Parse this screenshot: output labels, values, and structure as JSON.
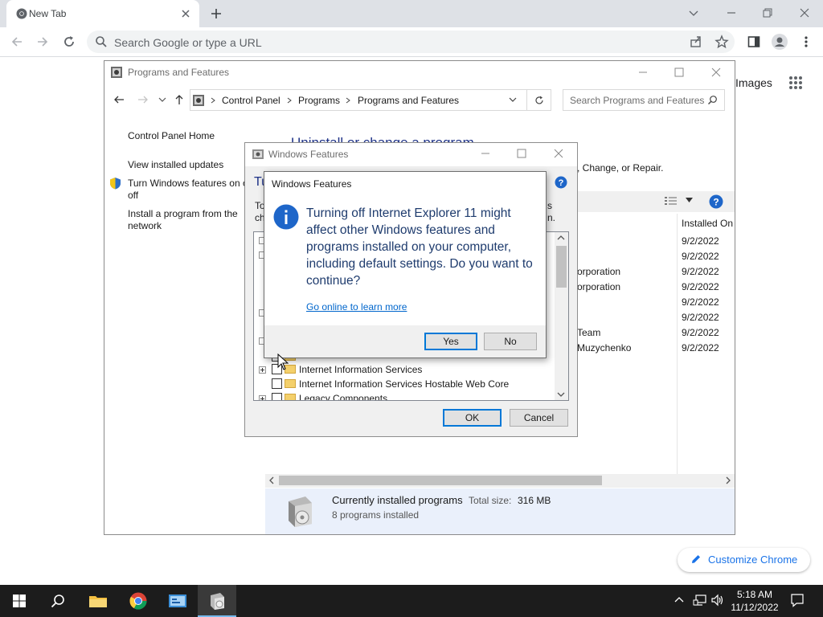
{
  "browser": {
    "tab_title": "New Tab",
    "omnibox_placeholder": "Search Google or type a URL",
    "images_link": "Images",
    "customize_label": "Customize Chrome"
  },
  "programs_window": {
    "title": "Programs and Features",
    "breadcrumbs": [
      "Control Panel",
      "Programs",
      "Programs and Features"
    ],
    "search_placeholder": "Search Programs and Features",
    "sidebar": {
      "home": "Control Panel Home",
      "updates": "View installed updates",
      "features_line1": "Turn Windows features on or",
      "features_line2": "off",
      "network_line1": "Install a program from the",
      "network_line2": "network"
    },
    "heading": "Uninstall or change a program",
    "subheading_tail": ", Change, or Repair.",
    "installed_on_header": "Installed On",
    "rows": [
      {
        "publisher": "",
        "date": "9/2/2022"
      },
      {
        "publisher": "",
        "date": "9/2/2022"
      },
      {
        "publisher": "orporation",
        "date": "9/2/2022"
      },
      {
        "publisher": "orporation",
        "date": "9/2/2022"
      },
      {
        "publisher": "",
        "date": "9/2/2022"
      },
      {
        "publisher": "",
        "date": "9/2/2022"
      },
      {
        "publisher": "Team",
        "date": "9/2/2022"
      },
      {
        "publisher": "Muzychenko",
        "date": "9/2/2022"
      }
    ],
    "status_title": "Currently installed programs",
    "status_total_label": "Total size:",
    "status_total_value": "316 MB",
    "status_count": "8 programs installed"
  },
  "features_dialog": {
    "title": "Windows Features",
    "heading_partial": "Tu",
    "desc_partial_1": "To",
    "desc_partial_2": "ch",
    "desc_tail_1": "s",
    "desc_tail_2": "n.",
    "tree_items": [
      "Internet Information Services",
      "Internet Information Services Hostable Web Core",
      "Legacy Components"
    ],
    "ok_label": "OK",
    "cancel_label": "Cancel"
  },
  "message_box": {
    "title": "Windows Features",
    "message": "Turning off Internet Explorer 11 might affect other Windows features and programs installed on your computer, including default settings. Do you want to continue?",
    "link": "Go online to learn more",
    "yes_label": "Yes",
    "no_label": "No"
  },
  "taskbar": {
    "time": "5:18 AM",
    "date": "11/12/2022"
  },
  "colors": {
    "accent": "#0078d7",
    "chrome_blue": "#1a73e8",
    "taskbar": "#1c1c1c"
  }
}
